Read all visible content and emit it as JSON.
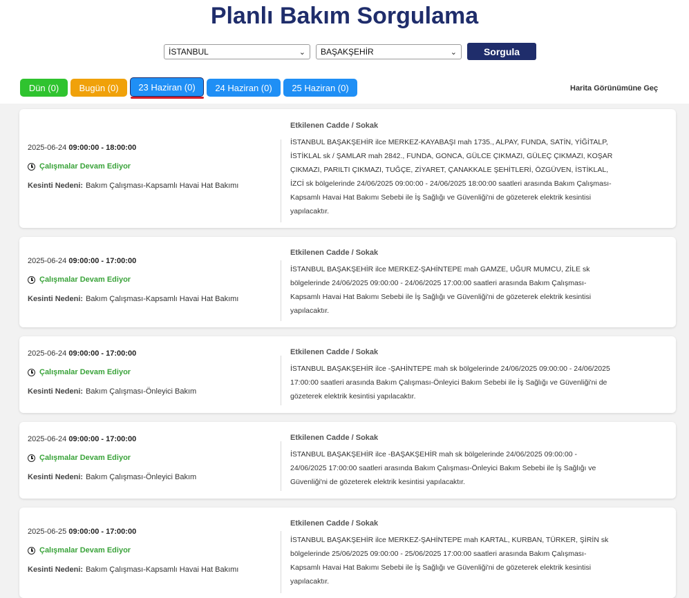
{
  "header": {
    "title": "Planlı Bakım Sorgulama"
  },
  "filters": {
    "city": "İSTANBUL",
    "district": "BAŞAKŞEHİR",
    "query_button": "Sorgula"
  },
  "tabs": [
    {
      "label": "Dün (0)",
      "color": "#2fc32f"
    },
    {
      "label": "Bugün (0)",
      "color": "#f0a10a"
    },
    {
      "label": "23 Haziran (0)",
      "color": "#1f8ff5",
      "active": true
    },
    {
      "label": "24 Haziran (0)",
      "color": "#1f8ff5"
    },
    {
      "label": "25 Haziran (0)",
      "color": "#1f8ff5"
    }
  ],
  "map_link": "Harita Görünümüne Geç",
  "labels": {
    "affected_streets": "Etkilenen Cadde / Sokak",
    "reason_label": "Kesinti Nedeni:",
    "status": "Çalışmalar Devam Ediyor"
  },
  "outages": [
    {
      "date": "2025-06-24",
      "time": "09:00:00 - 18:00:00",
      "reason": "Bakım Çalışması-Kapsamlı Havai Hat Bakımı",
      "description": "İSTANBUL BAŞAKŞEHİR ilce MERKEZ-KAYABAŞI mah 1735., ALPAY, FUNDA, SATİN, YİĞİTALP, İSTİKLAL sk / ŞAMLAR mah 2842., FUNDA, GONCA, GÜLCE ÇIKMAZI, GÜLEÇ ÇIKMAZI, KOŞAR ÇIKMAZI, PARILTI ÇIKMAZI, TUĞÇE, ZİYARET, ÇANAKKALE ŞEHİTLERİ, ÖZGÜVEN, İSTİKLAL, İZCİ sk bölgelerinde 24/06/2025 09:00:00 - 24/06/2025 18:00:00 saatleri arasında Bakım Çalışması-Kapsamlı Havai Hat Bakımı Sebebi ile İş Sağlığı ve Güvenliği'ni de gözeterek elektrik kesintisi yapılacaktır."
    },
    {
      "date": "2025-06-24",
      "time": "09:00:00 - 17:00:00",
      "reason": "Bakım Çalışması-Kapsamlı Havai Hat Bakımı",
      "description": "İSTANBUL BAŞAKŞEHİR ilce MERKEZ-ŞAHİNTEPE mah GAMZE, UĞUR MUMCU, ZİLE sk bölgelerinde 24/06/2025 09:00:00 - 24/06/2025 17:00:00 saatleri arasında Bakım Çalışması-Kapsamlı Havai Hat Bakımı Sebebi ile İş Sağlığı ve Güvenliği'ni de gözeterek elektrik kesintisi yapılacaktır."
    },
    {
      "date": "2025-06-24",
      "time": "09:00:00 - 17:00:00",
      "reason": "Bakım Çalışması-Önleyici Bakım",
      "description": "İSTANBUL BAŞAKŞEHİR ilce -ŞAHİNTEPE mah sk bölgelerinde 24/06/2025 09:00:00 - 24/06/2025 17:00:00 saatleri arasında Bakım Çalışması-Önleyici Bakım Sebebi ile İş Sağlığı ve Güvenliği'ni de gözeterek elektrik kesintisi yapılacaktır."
    },
    {
      "date": "2025-06-24",
      "time": "09:00:00 - 17:00:00",
      "reason": "Bakım Çalışması-Önleyici Bakım",
      "description": "İSTANBUL BAŞAKŞEHİR ilce -BAŞAKŞEHİR mah sk bölgelerinde 24/06/2025 09:00:00 - 24/06/2025 17:00:00 saatleri arasında Bakım Çalışması-Önleyici Bakım Sebebi ile İş Sağlığı ve Güvenliği'ni de gözeterek elektrik kesintisi yapılacaktır."
    },
    {
      "date": "2025-06-25",
      "time": "09:00:00 - 17:00:00",
      "reason": "Bakım Çalışması-Kapsamlı Havai Hat Bakımı",
      "description": "İSTANBUL BAŞAKŞEHİR ilce MERKEZ-ŞAHİNTEPE mah KARTAL, KURBAN, TÜRKER, ŞİRİN sk bölgelerinde 25/06/2025 09:00:00 - 25/06/2025 17:00:00 saatleri arasında Bakım Çalışması-Kapsamlı Havai Hat Bakımı Sebebi ile İş Sağlığı ve Güvenliği'ni de gözeterek elektrik kesintisi yapılacaktır."
    }
  ]
}
